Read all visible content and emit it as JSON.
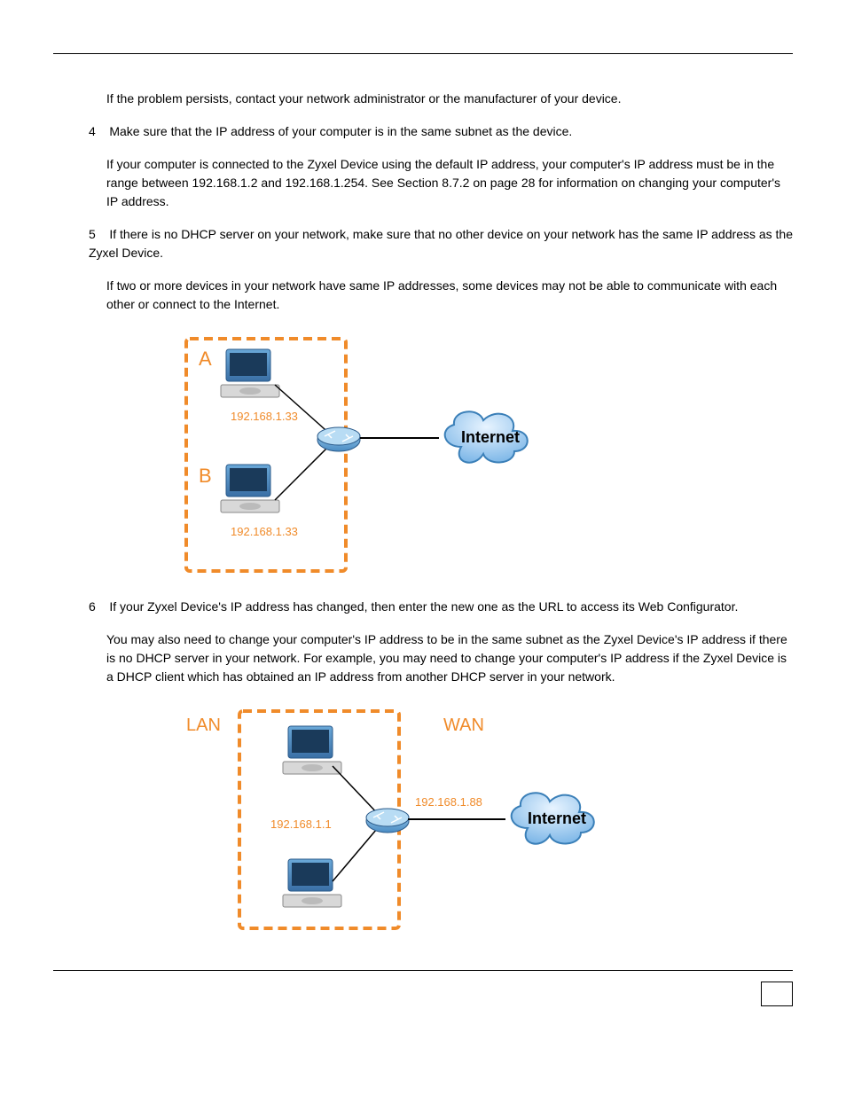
{
  "paragraphs": {
    "p1": "If the problem persists, contact your network administrator or the manufacturer of your device.",
    "p2_prefix": "4",
    "p2": "Make sure that the IP address of your computer is in the same subnet as the device.",
    "p2b": "If your computer is connected to the Zyxel Device using the default IP address, your computer's IP address must be in the range between 192.168.1.2 and 192.168.1.254. See Section 8.7.2 on page 28 for information on changing your computer's IP address.",
    "p3_prefix": "5",
    "p3": "If there is no DHCP server on your network, make sure that no other device on your network has the same IP address as the Zyxel Device.",
    "p3b": "If two or more devices in your network have same IP addresses, some devices may not be able to communicate with each other or connect to the Internet.",
    "p4_prefix": "6",
    "p4": "If your Zyxel Device's IP address has changed, then enter the new one as the URL to access its Web Configurator.",
    "p4b": "You may also need to change your computer's IP address to be in the same subnet as the Zyxel Device's IP address if there is no DHCP server in your network. For example, you may need to change your computer's IP address if the Zyxel Device is a DHCP client which has obtained an IP address from another DHCP server in your network."
  },
  "figure1": {
    "labelA": "A",
    "labelB": "B",
    "ipA": "192.168.1.33",
    "ipB": "192.168.1.33",
    "cloud": "Internet"
  },
  "figure2": {
    "lan": "LAN",
    "wan": "WAN",
    "lanIp": "192.168.1.1",
    "wanIp": "192.168.1.88",
    "cloud": "Internet"
  }
}
